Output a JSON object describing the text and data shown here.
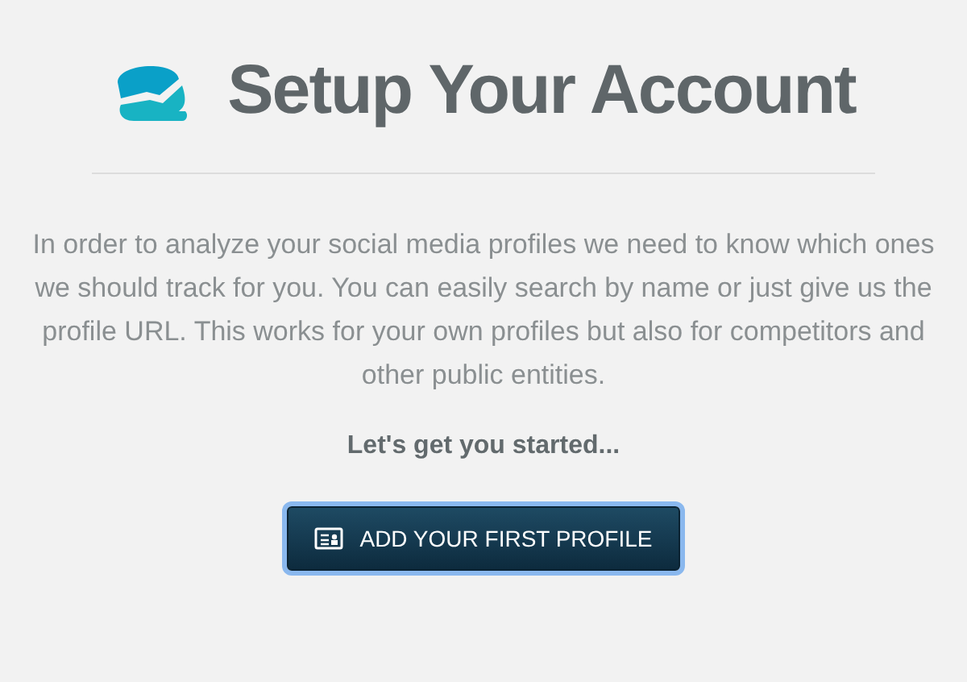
{
  "header": {
    "title": "Setup Your Account"
  },
  "intro": "In order to analyze your social media profiles we need to know which ones we should track for you. You can easily search by name or just give us the profile URL. This works for your own profiles but also for competitors and other public entities.",
  "prompt": "Let's get you started...",
  "button": {
    "label": "ADD YOUR FIRST PROFILE",
    "focused": true
  }
}
